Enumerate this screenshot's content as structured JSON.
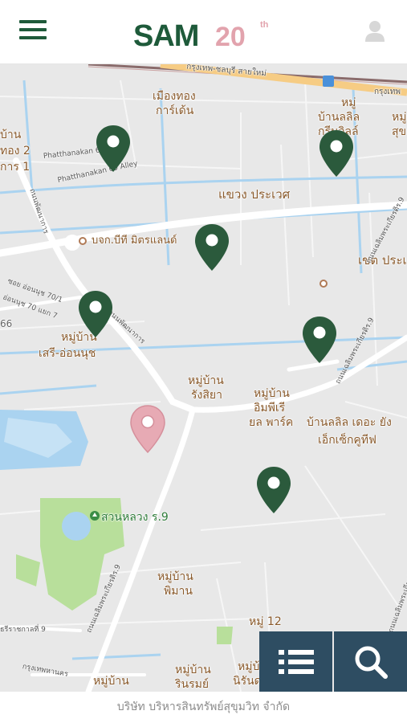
{
  "header": {
    "menu_icon": "hamburger-menu-icon",
    "logo_text": "SAM",
    "logo_number": "20",
    "logo_suffix": "th",
    "user_icon": "user-icon"
  },
  "colors": {
    "brand_green": "#1e5a3a",
    "logo_pink": "#e2a3ad",
    "pin_green": "#2b5a3c",
    "pin_pink": "#e7aab4",
    "fab_bg": "#2e4d62",
    "map_bg": "#e8e8e8",
    "water": "#aad3f0",
    "park": "#b8df9b"
  },
  "map": {
    "labels": {
      "l1": "กรุงเทพ-ชลบุรี สายใหม่",
      "l2": "เมืองทอง",
      "l3": "การ์เด้น",
      "l4": "หมู่",
      "l5": "บ้านลลิล",
      "l6": "กรีนวิลล์",
      "l7": "หมู่",
      "l8": "สุข",
      "l9": "บ้าน",
      "l10": "ทอง 2",
      "l11": "การ 1",
      "l12": "แขวง ประเวศ",
      "l13": "บจก.บีที มิตรแลนด์",
      "l14": "เขต ประเ",
      "l15": "หมู่บ้าน",
      "l16": "เสรี-อ่อนนุช",
      "l17": "หมู่บ้าน",
      "l18": "รังสิยา",
      "l19": "หมู่บ้าน",
      "l20": "อิมพีเรี",
      "l21": "ยล พาร์ค",
      "l22": "บ้านลลิล เดอะ ยัง",
      "l23": "เอ็กเซ็กคูทีฟ",
      "l24": "สวนหลวง ร.9",
      "l25": "หมู่บ้าน",
      "l26": "พิมาน",
      "l27": "หมู่ 12",
      "l28": "หมู่บ้าน",
      "l29": "รินรมย์",
      "l30": "หมู่บ้าน",
      "l31": "นิรันด",
      "l32": "หมู่บ้าน",
      "l33": "66",
      "l34": "กรุงเทพ"
    },
    "road_labels": {
      "r1": "Phatthanakan 65",
      "r2": "Phatthanakan 69 Alley",
      "r3": "ถนนพัฒนาการ",
      "r4": "ซอย อ่อนนุช 70/1",
      "r5": "อ่อนนุช 70 แยก 7",
      "r6": "ถนนเฉลิมพระเกียรติร.9",
      "r7": "ถนนเฉลิมพระเกียรติร.9",
      "r8": "ถนนเฉลิมพระเกียรติร.9",
      "r9": "ถนนเฉลิมพระเกียรติร.9",
      "r10": "ถนนพัฒนาการ",
      "r11": "ธรีราชกาลที่ 9",
      "r12": "กรุงเทพหานคร"
    },
    "pins": [
      {
        "name": "property-pin",
        "color": "green"
      },
      {
        "name": "property-pin",
        "color": "green"
      },
      {
        "name": "property-pin",
        "color": "green"
      },
      {
        "name": "property-pin",
        "color": "green"
      },
      {
        "name": "property-pin",
        "color": "green"
      },
      {
        "name": "property-pin",
        "color": "green"
      },
      {
        "name": "selected-location-pin",
        "color": "pink"
      }
    ]
  },
  "buttons": {
    "list_icon": "list-icon",
    "search_icon": "search-icon"
  },
  "footer": {
    "text": "บริษัท บริหารสินทรัพย์สุขุมวิท จำกัด"
  }
}
